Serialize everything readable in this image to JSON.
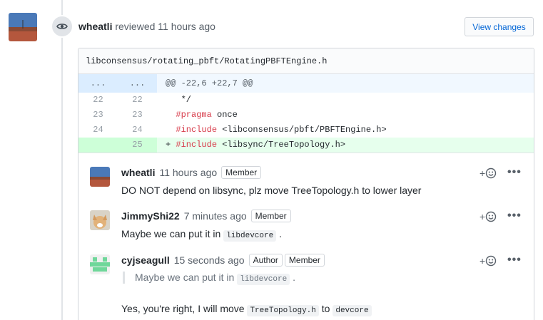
{
  "review": {
    "author": "wheatli",
    "action": "reviewed",
    "time": "11 hours ago",
    "view_changes_label": "View changes"
  },
  "file": {
    "path": "libconsensus/rotating_pbft/RotatingPBFTEngine.h",
    "hunk": {
      "left": "...",
      "right": "...",
      "text": "@@ -22,6 +22,7 @@"
    },
    "lines": [
      {
        "old": "22",
        "new": "22",
        "marker": "",
        "text": "   */"
      },
      {
        "old": "23",
        "new": "23",
        "marker": "",
        "kw": "#pragma",
        "rest": " once"
      },
      {
        "old": "24",
        "new": "24",
        "marker": "",
        "kw": "#include",
        "rest": " <libconsensus/pbft/PBFTEngine.h>"
      },
      {
        "old": "",
        "new": "25",
        "marker": "+",
        "kw": "#include",
        "rest": " <libsync/TreeTopology.h>"
      }
    ]
  },
  "comments": [
    {
      "author": "wheatli",
      "time": "11 hours ago",
      "labels": [
        "Member"
      ],
      "body": "DO NOT depend on libsync, plz move TreeTopology.h to lower layer"
    },
    {
      "author": "JimmyShi22",
      "time": "7 minutes ago",
      "labels": [
        "Member"
      ],
      "body_pre": "Maybe we can put it in ",
      "body_code": "libdevcore",
      "body_post": " ."
    },
    {
      "author": "cyjseagull",
      "time": "15 seconds ago",
      "labels": [
        "Author",
        "Member"
      ],
      "quote_pre": "Maybe we can put it in ",
      "quote_code": "libdevcore",
      "quote_post": " .",
      "body_pre": "Yes, you're right, I will move ",
      "body_code1": "TreeTopology.h",
      "body_mid": " to ",
      "body_code2": "devcore"
    }
  ],
  "reaction": {
    "plus": "+",
    "icon": "smiley-icon"
  },
  "more": "•••"
}
